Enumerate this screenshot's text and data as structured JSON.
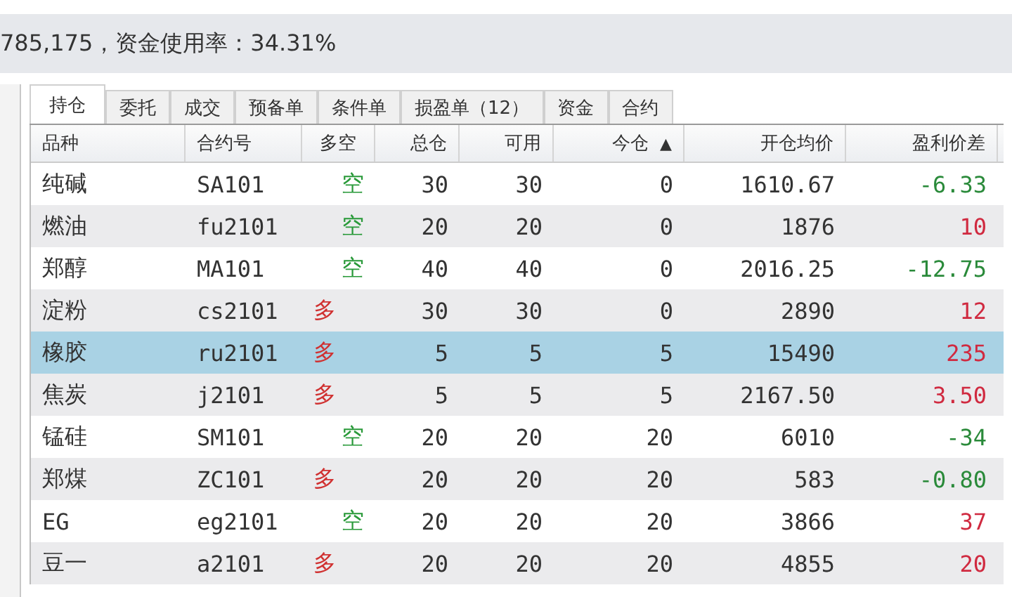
{
  "summary": "785,175，资金使用率：34.31%",
  "tabs": [
    {
      "label": "持仓",
      "selected": true
    },
    {
      "label": "委托",
      "selected": false
    },
    {
      "label": "成交",
      "selected": false
    },
    {
      "label": "预备单",
      "selected": false
    },
    {
      "label": "条件单",
      "selected": false
    },
    {
      "label": "损盈单（12）",
      "selected": false
    },
    {
      "label": "资金",
      "selected": false
    },
    {
      "label": "合约",
      "selected": false
    }
  ],
  "table": {
    "columns": [
      {
        "label": "品种"
      },
      {
        "label": "合约号"
      },
      {
        "label": "多空"
      },
      {
        "label": "总仓"
      },
      {
        "label": "可用"
      },
      {
        "label": "今仓",
        "sort": "▲"
      },
      {
        "label": "开仓均价"
      },
      {
        "label": "盈利价差"
      }
    ],
    "rows": [
      {
        "selected": false,
        "cells": [
          "纯碱",
          "SA101",
          {
            "text": "空",
            "kind": "short"
          },
          "30",
          "30",
          "0",
          "1610.67",
          {
            "text": "-6.33",
            "kind": "loss"
          }
        ]
      },
      {
        "selected": false,
        "cells": [
          "燃油",
          "fu2101",
          {
            "text": "空",
            "kind": "short"
          },
          "20",
          "20",
          "0",
          "1876",
          {
            "text": "10",
            "kind": "gain"
          }
        ]
      },
      {
        "selected": false,
        "cells": [
          "郑醇",
          "MA101",
          {
            "text": "空",
            "kind": "short"
          },
          "40",
          "40",
          "0",
          "2016.25",
          {
            "text": "-12.75",
            "kind": "loss"
          }
        ]
      },
      {
        "selected": false,
        "cells": [
          "淀粉",
          "cs2101",
          {
            "text": "多",
            "kind": "long"
          },
          "30",
          "30",
          "0",
          "2890",
          {
            "text": "12",
            "kind": "gain"
          }
        ]
      },
      {
        "selected": true,
        "cells": [
          "橡胶",
          "ru2101",
          {
            "text": "多",
            "kind": "long"
          },
          "5",
          "5",
          "5",
          "15490",
          {
            "text": "235",
            "kind": "gain"
          }
        ]
      },
      {
        "selected": false,
        "cells": [
          "焦炭",
          "j2101",
          {
            "text": "多",
            "kind": "long"
          },
          "5",
          "5",
          "5",
          "2167.50",
          {
            "text": "3.50",
            "kind": "gain"
          }
        ]
      },
      {
        "selected": false,
        "cells": [
          "锰硅",
          "SM101",
          {
            "text": "空",
            "kind": "short"
          },
          "20",
          "20",
          "20",
          "6010",
          {
            "text": "-34",
            "kind": "loss"
          }
        ]
      },
      {
        "selected": false,
        "cells": [
          "郑煤",
          "ZC101",
          {
            "text": "多",
            "kind": "long"
          },
          "20",
          "20",
          "20",
          "583",
          {
            "text": "-0.80",
            "kind": "loss"
          }
        ]
      },
      {
        "selected": false,
        "cells": [
          "EG",
          "eg2101",
          {
            "text": "空",
            "kind": "short"
          },
          "20",
          "20",
          "20",
          "3866",
          {
            "text": "37",
            "kind": "gain"
          }
        ]
      },
      {
        "selected": false,
        "cells": [
          "豆一",
          "a2101",
          {
            "text": "多",
            "kind": "long"
          },
          "20",
          "20",
          "20",
          "4855",
          {
            "text": "20",
            "kind": "gain"
          }
        ]
      }
    ]
  }
}
